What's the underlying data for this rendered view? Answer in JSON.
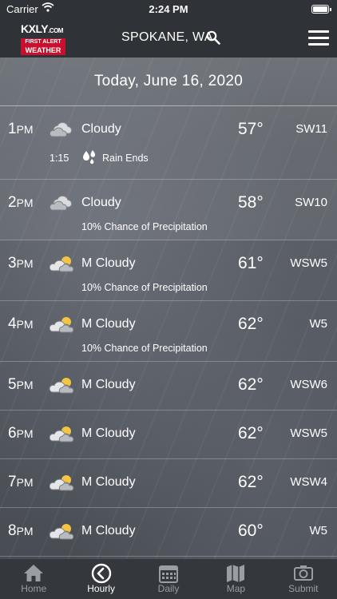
{
  "status_bar": {
    "carrier": "Carrier",
    "time": "2:24 PM"
  },
  "header": {
    "logo": {
      "line1": "KXLY",
      "line1_suffix": ".COM",
      "line2": "FIRST ALERT",
      "line3": "WEATHER"
    },
    "location": "SPOKANE, WA"
  },
  "date_bar": {
    "text": "Today, June 16, 2020"
  },
  "rows": [
    {
      "hour": "1",
      "ampm": "PM",
      "condition": "Cloudy",
      "temp": "57°",
      "wind": "SW11",
      "icon": "cloudy-icon",
      "event_time": "1:15",
      "event_label": "Rain Ends"
    },
    {
      "hour": "2",
      "ampm": "PM",
      "condition": "Cloudy",
      "temp": "58°",
      "wind": "SW10",
      "icon": "cloudy-icon",
      "precip": "10% Chance of Precipitation"
    },
    {
      "hour": "3",
      "ampm": "PM",
      "condition": "M Cloudy",
      "temp": "61°",
      "wind": "WSW5",
      "icon": "mostly-cloudy-icon",
      "precip": "10% Chance of Precipitation"
    },
    {
      "hour": "4",
      "ampm": "PM",
      "condition": "M Cloudy",
      "temp": "62°",
      "wind": "W5",
      "icon": "mostly-cloudy-icon",
      "precip": "10% Chance of Precipitation"
    },
    {
      "hour": "5",
      "ampm": "PM",
      "condition": "M Cloudy",
      "temp": "62°",
      "wind": "WSW6",
      "icon": "mostly-cloudy-icon"
    },
    {
      "hour": "6",
      "ampm": "PM",
      "condition": "M Cloudy",
      "temp": "62°",
      "wind": "WSW5",
      "icon": "mostly-cloudy-icon"
    },
    {
      "hour": "7",
      "ampm": "PM",
      "condition": "M Cloudy",
      "temp": "62°",
      "wind": "WSW4",
      "icon": "mostly-cloudy-icon"
    },
    {
      "hour": "8",
      "ampm": "PM",
      "condition": "M Cloudy",
      "temp": "60°",
      "wind": "W5",
      "icon": "mostly-cloudy-icon"
    }
  ],
  "tabs": [
    {
      "label": "Home",
      "icon": "home-icon"
    },
    {
      "label": "Hourly",
      "icon": "clock-icon",
      "active": true
    },
    {
      "label": "Daily",
      "icon": "calendar-icon"
    },
    {
      "label": "Map",
      "icon": "map-icon"
    },
    {
      "label": "Submit",
      "icon": "camera-icon"
    }
  ],
  "colors": {
    "logo_red": "#c8102e",
    "bar_bg": "#2f3236",
    "tab_bg": "#34373c",
    "tab_inactive": "#9a9da2"
  }
}
